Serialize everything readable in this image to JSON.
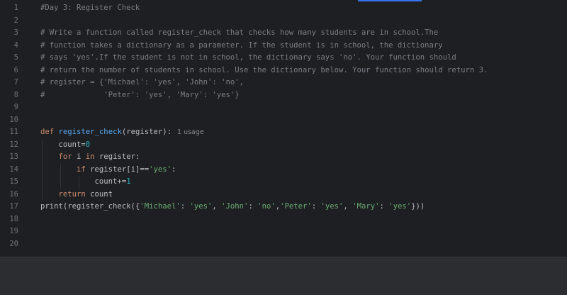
{
  "editor": {
    "line_numbers": [
      "1",
      "2",
      "3",
      "4",
      "5",
      "6",
      "7",
      "8",
      "9",
      "10",
      "11",
      "12",
      "13",
      "14",
      "15",
      "16",
      "17",
      "18",
      "19",
      "20"
    ],
    "lines": {
      "l1": "#Day 3: Register Check",
      "l3": "# Write a function called register_check that checks how many students are in school.The",
      "l4": "# function takes a dictionary as a parameter. If the student is in school, the dictionary",
      "l5": "# says 'yes'.If the student is not in school, the dictionary says 'no'. Your function should",
      "l6": "# return the number of students in school. Use the dictionary below. Your function should return 3.",
      "l7": "# register = {'Michael': 'yes', 'John': 'no',",
      "l8": "#             'Peter': 'yes', 'Mary': 'yes'}",
      "l11": {
        "def": "def",
        "fn": "register_check",
        "args": "(register):",
        "hint": "1 usage"
      },
      "l12": {
        "a": "    count=",
        "b": "0"
      },
      "l13": {
        "kw1": "for",
        "a": " i ",
        "kw2": "in",
        "b": " register:"
      },
      "l14": {
        "kw": "if",
        "a": " register[i]==",
        "s": "'yes'",
        "b": ":"
      },
      "l15": {
        "a": "count+=",
        "b": "1"
      },
      "l16": {
        "kw": "return",
        "a": " count"
      },
      "l17": {
        "print": "print",
        "p1": "(register_check({",
        "k1": "'Michael'",
        "c1": ": ",
        "v1": "'yes'",
        "s1": ", ",
        "k2": "'John'",
        "c2": ": ",
        "v2": "'no'",
        "s2": ",",
        "k3": "'Peter'",
        "c3": ": ",
        "v3": "'yes'",
        "s3": ", ",
        "k4": "'Mary'",
        "c4": ": ",
        "v4": "'yes'",
        "end": "}))"
      }
    }
  },
  "colors": {
    "background": "#1e1f22",
    "comment": "#7a7e85",
    "keyword": "#cf8e6d",
    "function": "#56a8f5",
    "string": "#6aab73",
    "number": "#2aacb8",
    "default": "#bcbec4"
  }
}
